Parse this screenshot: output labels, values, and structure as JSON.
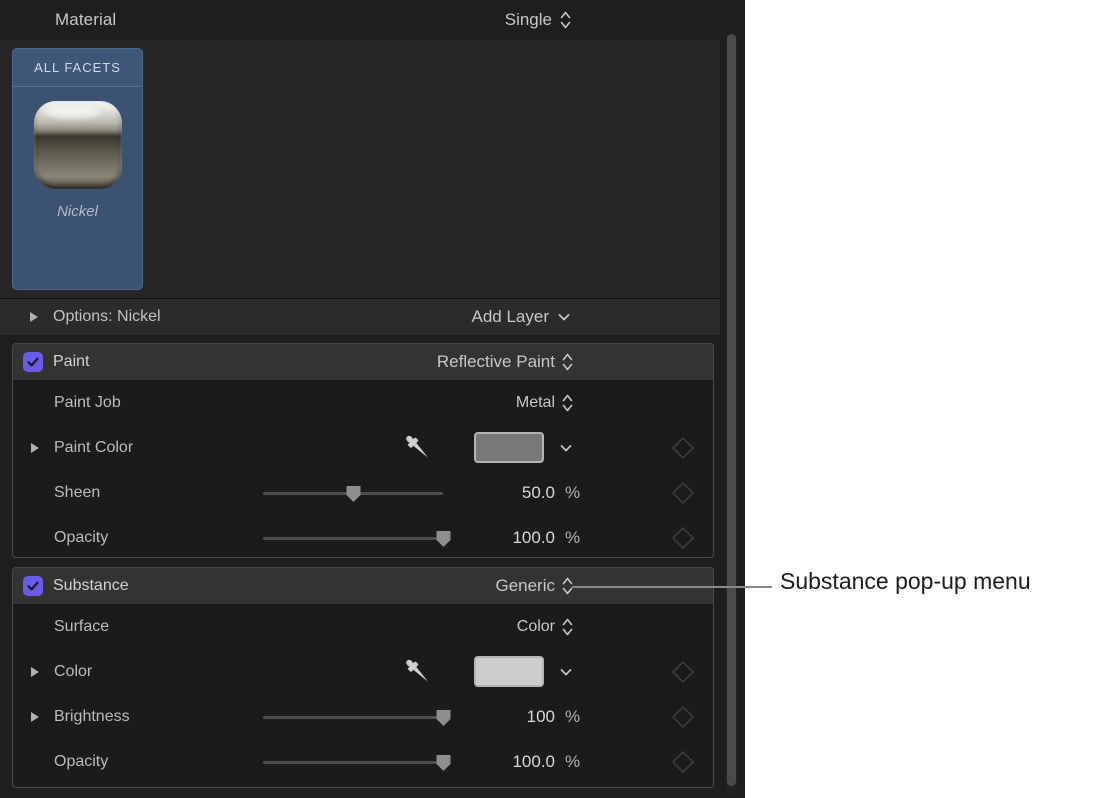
{
  "panel": {
    "header": {
      "title": "Material",
      "popup_value": "Single",
      "popup_icon": "up-down-chevron-icon"
    },
    "facets": {
      "tile_header": "ALL FACETS",
      "material_name": "Nickel",
      "swatch_icon": "nickel-material-sphere-icon"
    },
    "options": {
      "disclosure_icon": "disclosure-triangle-right-icon",
      "label": "Options: Nickel",
      "add_layer_label": "Add Layer",
      "add_layer_icon": "chevron-down-icon"
    },
    "groups": [
      {
        "id": "paint",
        "checked": true,
        "checkbox_icon": "checkmark-icon",
        "label": "Paint",
        "popup_value": "Reflective Paint",
        "popup_icon": "up-down-chevron-icon",
        "rows": [
          {
            "kind": "popup",
            "label": "Paint Job",
            "value": "Metal",
            "popup_icon": "up-down-chevron-icon",
            "has_disclosure": false
          },
          {
            "kind": "color",
            "label": "Paint Color",
            "has_disclosure": true,
            "eyedropper_icon": "eyedropper-icon",
            "swatch_color": "#787878",
            "swatch_chevron_icon": "chevron-down-icon",
            "keyframe_icon": "keyframe-diamond-icon"
          },
          {
            "kind": "slider",
            "label": "Sheen",
            "has_disclosure": false,
            "value": "50.0",
            "unit": "%",
            "slider_percent": 50,
            "keyframe_icon": "keyframe-diamond-icon"
          },
          {
            "kind": "slider",
            "label": "Opacity",
            "has_disclosure": false,
            "value": "100.0",
            "unit": "%",
            "slider_percent": 100,
            "keyframe_icon": "keyframe-diamond-icon"
          }
        ]
      },
      {
        "id": "substance",
        "checked": true,
        "checkbox_icon": "checkmark-icon",
        "label": "Substance",
        "popup_value": "Generic",
        "popup_icon": "up-down-chevron-icon",
        "rows": [
          {
            "kind": "popup",
            "label": "Surface",
            "value": "Color",
            "popup_icon": "up-down-chevron-icon",
            "has_disclosure": false
          },
          {
            "kind": "color",
            "label": "Color",
            "has_disclosure": true,
            "eyedropper_icon": "eyedropper-icon",
            "swatch_color": "#cdcdcd",
            "swatch_chevron_icon": "chevron-down-icon",
            "keyframe_icon": "keyframe-diamond-icon"
          },
          {
            "kind": "slider",
            "label": "Brightness",
            "has_disclosure": true,
            "value": "100",
            "unit": "%",
            "slider_percent": 100,
            "keyframe_icon": "keyframe-diamond-icon"
          },
          {
            "kind": "slider",
            "label": "Opacity",
            "has_disclosure": false,
            "value": "100.0",
            "unit": "%",
            "slider_percent": 100,
            "keyframe_icon": "keyframe-diamond-icon"
          }
        ]
      }
    ],
    "scrollbar_present": true
  },
  "callout": {
    "text": "Substance pop-up menu"
  },
  "colors": {
    "accent_checkbox": "#6b5ce8",
    "panel_background": "#1e1e1e",
    "group_header_background": "#333333",
    "facet_tile_background": "#3c5272",
    "callout_background": "#ffffff"
  }
}
